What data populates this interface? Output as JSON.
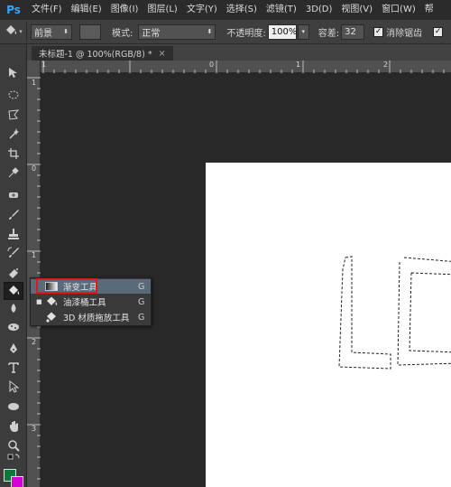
{
  "menubar": {
    "logo": "Ps",
    "items": [
      {
        "label": "文件(F)"
      },
      {
        "label": "编辑(E)"
      },
      {
        "label": "图像(I)"
      },
      {
        "label": "图层(L)"
      },
      {
        "label": "文字(Y)"
      },
      {
        "label": "选择(S)"
      },
      {
        "label": "滤镜(T)"
      },
      {
        "label": "3D(D)"
      },
      {
        "label": "视图(V)"
      },
      {
        "label": "窗口(W)"
      },
      {
        "label": "帮"
      }
    ]
  },
  "options": {
    "fill_source": "前景",
    "mode_label": "模式:",
    "mode_value": "正常",
    "opacity_label": "不透明度:",
    "opacity_value": "100%",
    "tolerance_label": "容差:",
    "tolerance_value": "32",
    "antialias_label": "消除锯齿",
    "antialias_checked": "✓"
  },
  "document": {
    "tab_title": "未标题-1 @ 100%(RGB/8) *",
    "close": "×"
  },
  "ruler": {
    "h": [
      "1",
      "0",
      "1",
      "2"
    ],
    "v": [
      "1",
      "0",
      "1",
      "2",
      "3"
    ]
  },
  "flyout": {
    "items": [
      {
        "label": "渐变工具",
        "key": "G",
        "bullet": "",
        "icon": "gradient-icon"
      },
      {
        "label": "油漆桶工具",
        "key": "G",
        "bullet": "■",
        "icon": "paint-bucket-icon"
      },
      {
        "label": "3D 材质拖放工具",
        "key": "G",
        "bullet": "",
        "icon": "3d-material-drop-icon"
      }
    ]
  },
  "colors": {
    "foreground": "#0a7a3a",
    "background": "#d600d6",
    "highlight": "#e01919",
    "ps_blue": "#31a8ff"
  }
}
